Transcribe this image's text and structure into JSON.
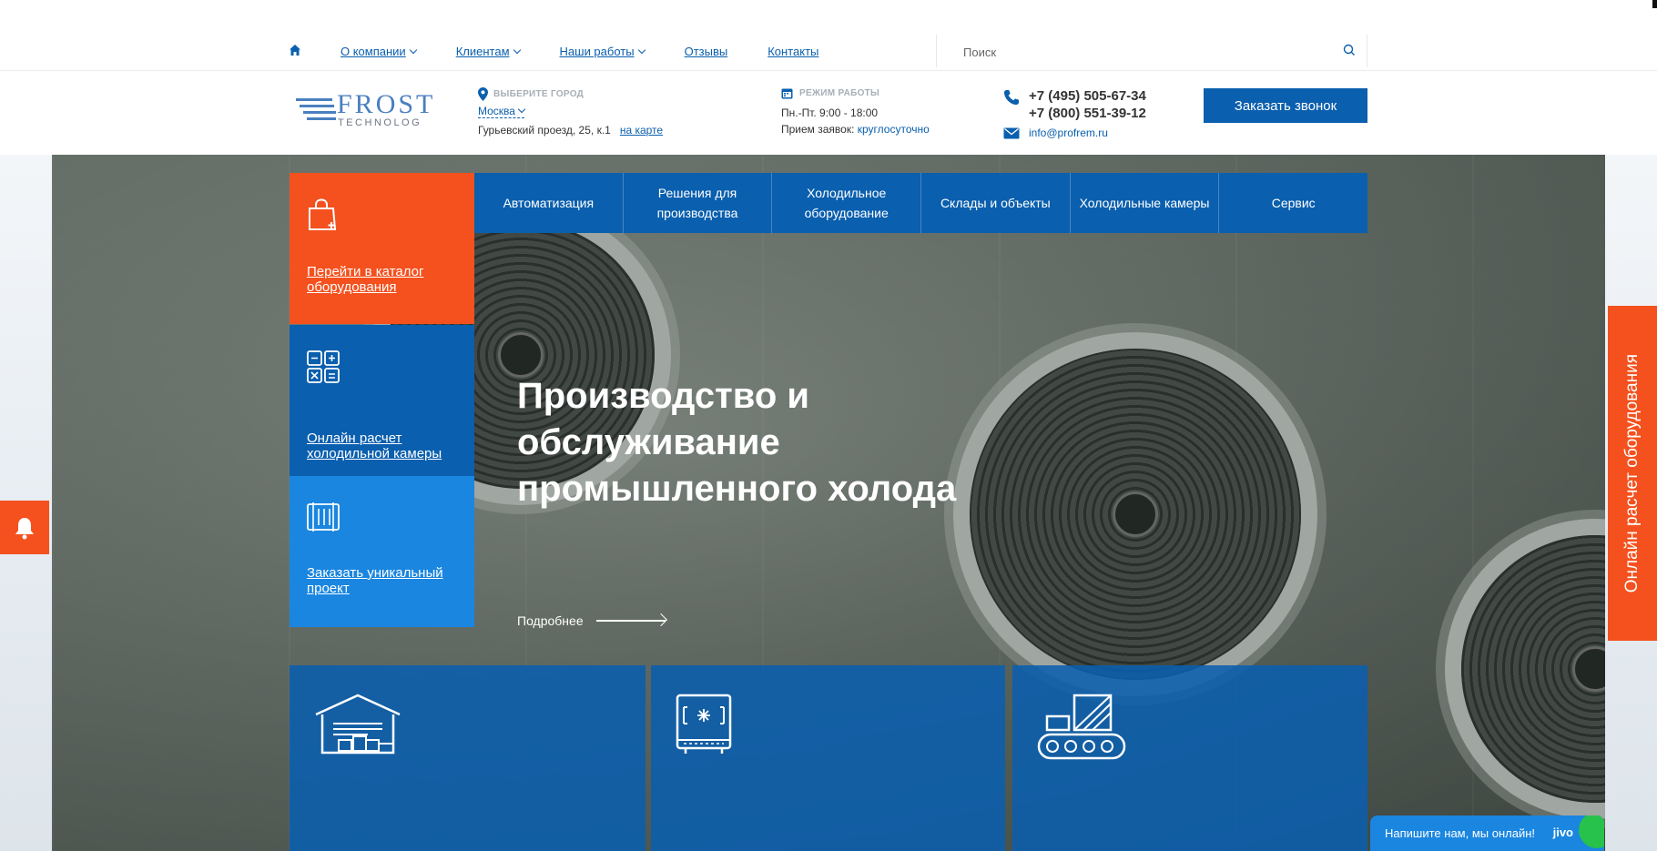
{
  "topnav": {
    "links": [
      {
        "label": "О компании",
        "dropdown": true
      },
      {
        "label": "Клиентам",
        "dropdown": true
      },
      {
        "label": "Наши работы",
        "dropdown": true
      },
      {
        "label": "Отзывы",
        "dropdown": false
      },
      {
        "label": "Контакты",
        "dropdown": false
      }
    ],
    "search_placeholder": "Поиск"
  },
  "header": {
    "logo_main": "FROST",
    "logo_sub": "TECHNOLOG",
    "city_label": "ВЫБЕРИТЕ ГОРОД",
    "city_name": "Москва",
    "address": "Гурьевский проезд, 25, к.1",
    "map_link": "на карте",
    "hours_label": "РЕЖИМ РАБОТЫ",
    "hours_line1": "Пн.-Пт. 9:00 - 18:00",
    "hours_line2_prefix": "Прием заявок: ",
    "hours_line2_accent": "круглосуточно",
    "phone1": "+7 (495) 505-67-34",
    "phone2": "+7 (800) 551-39-12",
    "email": "info@profrem.ru",
    "call_button": "Заказать звонок"
  },
  "catnav": [
    "Автоматизация",
    "Решения для производства",
    "Холодильное оборудование",
    "Склады и объекты",
    "Холодильные камеры",
    "Сервис"
  ],
  "tiles": {
    "catalog": "Перейти в каталог оборудования",
    "calc": "Онлайн расчет холодильной камеры",
    "project": "Заказать уникальный проект"
  },
  "hero": {
    "title": "Производство и обслуживание промышленного холода",
    "more": "Подробнее"
  },
  "side": {
    "calc_tab": "Онлайн расчет оборудования"
  },
  "chat": {
    "text": "Напишите нам, мы онлайн!",
    "brand": "jivo"
  },
  "colors": {
    "primary": "#0a5fae",
    "accent": "#f4511e",
    "light_blue": "#1a86e0"
  },
  "icons": [
    "home-icon",
    "search-icon",
    "location-pin-icon",
    "calendar-icon",
    "phone-icon",
    "mail-icon",
    "shopping-bag-icon",
    "calculator-icon",
    "blueprint-icon",
    "warehouse-icon",
    "freezer-icon",
    "conveyor-icon",
    "bell-icon"
  ]
}
